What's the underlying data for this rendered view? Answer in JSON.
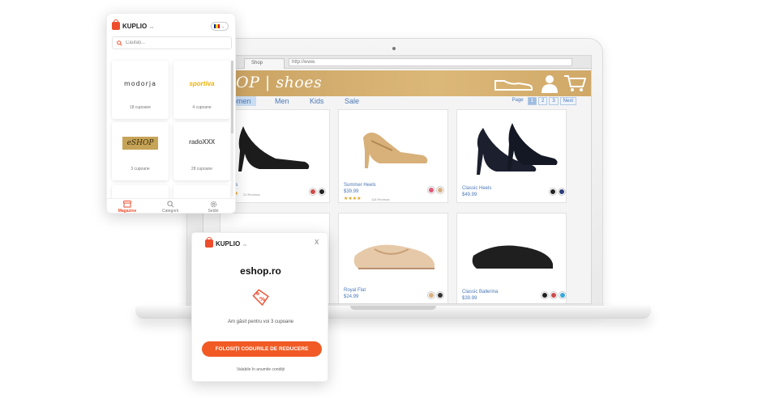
{
  "browser": {
    "tab_label": "Shop",
    "url": "http://www."
  },
  "shop": {
    "logo": "OP | shoes",
    "nav": [
      "omen",
      "Men",
      "Kids",
      "Sale"
    ],
    "pager": {
      "label": "Page",
      "pages": [
        "1",
        "2",
        "3"
      ],
      "next": "Next"
    },
    "products": [
      {
        "name": "Heels",
        "price": "",
        "stars": "★★★",
        "reviews": "22 Reviews",
        "swatches": [
          "#d04a4a",
          "#222222"
        ]
      },
      {
        "name": "Summer Heels",
        "price": "$39.99",
        "stars": "★★★★",
        "reviews": "118 Reviews",
        "swatches": [
          "#e05a7a",
          "#d9b080"
        ]
      },
      {
        "name": "Classic Heels",
        "price": "$49.99",
        "stars": "",
        "reviews": "",
        "swatches": [
          "#222222",
          "#2c3e7a"
        ]
      },
      {
        "name": "Royal Flat",
        "price": "$24.99",
        "stars": "",
        "reviews": "",
        "swatches": [
          "#d9b080",
          "#333333"
        ]
      },
      {
        "name": "Classic Ballerina",
        "price": "$39.99",
        "stars": "",
        "reviews": "",
        "swatches": [
          "#222222",
          "#d04a4a",
          "#3aa8d8"
        ]
      }
    ]
  },
  "extension": {
    "brand": "KUPLIO",
    "brand_tld": ".ro",
    "language_flag": [
      "#002b7f",
      "#fcd116",
      "#ce1126"
    ],
    "search": {
      "placeholder": "Căutați..."
    },
    "stores": [
      {
        "name": "modorja",
        "coupons": "18 cupoane"
      },
      {
        "name": "sportiva",
        "coupons": "4 cupoane"
      },
      {
        "name": "eSHOP",
        "coupons": "3 cupoane"
      },
      {
        "name": "radoXXX",
        "coupons": "28 cupoane"
      }
    ],
    "bottom_nav": [
      {
        "label": "Magazine",
        "icon": "store-icon",
        "active": true
      },
      {
        "label": "Categorii",
        "icon": "search-icon",
        "active": false
      },
      {
        "label": "Setări",
        "icon": "settings-icon",
        "active": false
      }
    ]
  },
  "popup": {
    "brand": "KUPLIO",
    "brand_tld": ".ro",
    "close": "X",
    "shop": "eshop.ro",
    "icon": "discount-tag-icon",
    "found_text": "Am găsit pentru voi 3 cupoane",
    "button_label": "Folosiți codurile de reducere",
    "validity": "Valabile în anumite condiții"
  },
  "colors": {
    "accent": "#f15a24",
    "shop_header": "#d4ac6c",
    "link_blue": "#4a78b8"
  }
}
